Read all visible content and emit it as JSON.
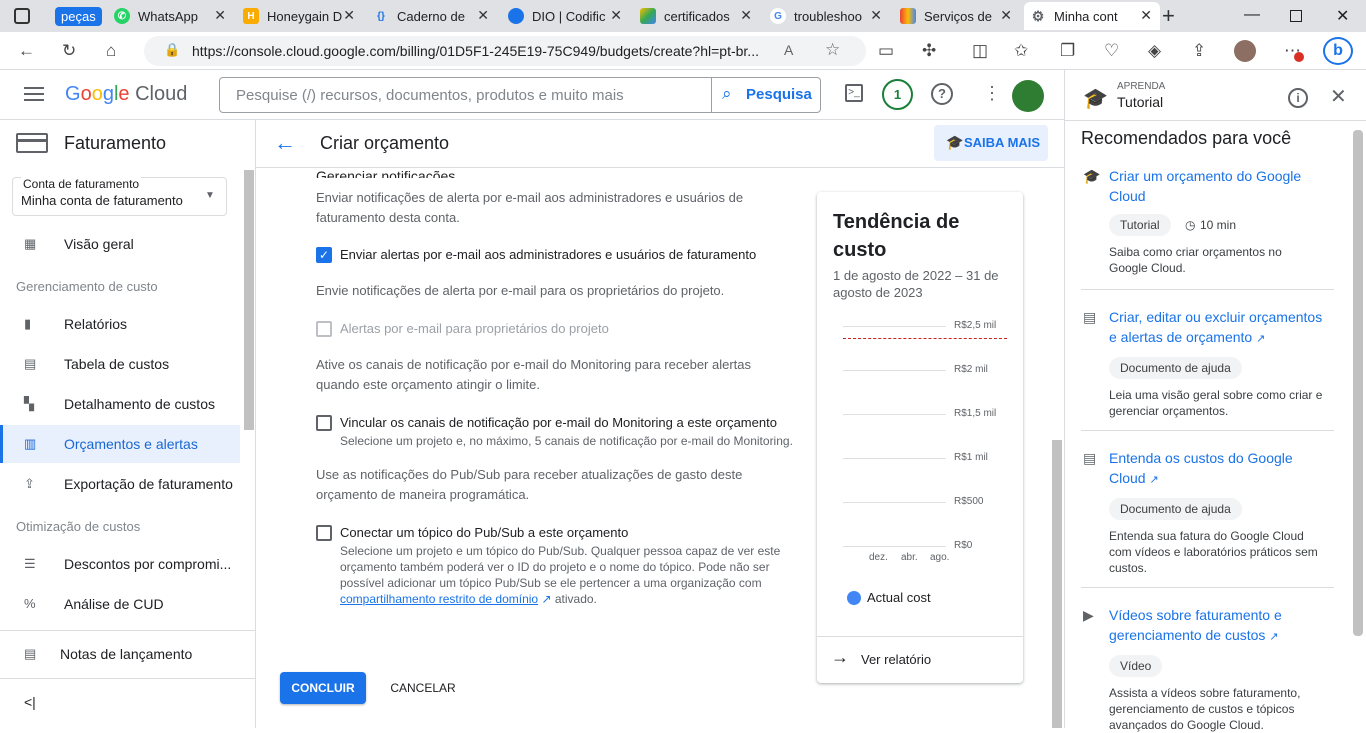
{
  "browser": {
    "tabs": [
      {
        "label": "peças",
        "color": "#1a73e8"
      },
      {
        "label": "WhatsApp",
        "color": "#25d366"
      },
      {
        "label": "Honeygain D",
        "color": "#f9ab00"
      },
      {
        "label": "Caderno de",
        "color": "#1a73e8"
      },
      {
        "label": "DIO | Codific",
        "color": "#1a73e8"
      },
      {
        "label": "certificados",
        "color": "#34a853"
      },
      {
        "label": "troubleshoo",
        "color": "#ea4335"
      },
      {
        "label": "Serviços de",
        "color": "#4285f4"
      },
      {
        "label": "Minha cont",
        "color": "#5f6368"
      }
    ],
    "url": "https://console.cloud.google.com/billing/01D5F1-245E19-75C949/budgets/create?hl=pt-br..."
  },
  "header": {
    "logo": "Google Cloud",
    "search_placeholder": "Pesquise (/) recursos, documentos, produtos e muito mais",
    "search_button": "Pesquisa",
    "notif_count": "1"
  },
  "sidebar": {
    "title": "Faturamento",
    "account_label": "Conta de faturamento",
    "account_value": "Minha conta de faturamento",
    "overview": "Visão geral",
    "section_cost": "Gerenciamento de custo",
    "reports": "Relatórios",
    "cost_table": "Tabela de custos",
    "cost_breakdown": "Detalhamento de custos",
    "budgets": "Orçamentos e alertas",
    "export": "Exportação de faturamento",
    "section_opt": "Otimização de custos",
    "commit": "Descontos por compromi...",
    "cud": "Análise de CUD",
    "release_notes": "Notas de lançamento"
  },
  "main": {
    "page_title": "Criar orçamento",
    "learn_more": "SAIBA MAIS",
    "section_heading": "Gerenciar notificações",
    "intro": "Enviar notificações de alerta por e-mail aos administradores e usuários de faturamento desta conta.",
    "cb1_label": "Enviar alertas por e-mail aos administradores e usuários de faturamento",
    "owners_text": "Envie notificações de alerta por e-mail para os proprietários do projeto.",
    "cb2_label": "Alertas por e-mail para proprietários do projeto",
    "monitoring_text": "Ative os canais de notificação por e-mail do Monitoring para receber alertas quando este orçamento atingir o limite.",
    "cb3_label": "Vincular os canais de notificação por e-mail do Monitoring a este orçamento",
    "cb3_sub": "Selecione um projeto e, no máximo, 5 canais de notificação por e-mail do Monitoring.",
    "pubsub_text": "Use as notificações do Pub/Sub para receber atualizações de gasto deste orçamento de maneira programática.",
    "cb4_label": "Conectar um tópico do Pub/Sub a este orçamento",
    "cb4_sub": "Selecione um projeto e um tópico do Pub/Sub. Qualquer pessoa capaz de ver este orçamento também poderá ver o ID do projeto e o nome do tópico. Pode não ser possível adicionar um tópico Pub/Sub se ele pertencer a uma organização com",
    "cb4_link": "compartilhamento restrito de domínio",
    "cb4_after": "ativado.",
    "done_button": "CONCLUIR",
    "cancel_button": "CANCELAR"
  },
  "trend": {
    "title": "Tendência de custo",
    "date_range": "1 de agosto de 2022 – 31 de agosto de 2023",
    "y_labels": [
      "R$2,5 mil",
      "R$2 mil",
      "R$1,5 mil",
      "R$1 mil",
      "R$500",
      "R$0"
    ],
    "x_labels": [
      "dez.",
      "abr.",
      "ago."
    ],
    "legend": "Actual cost",
    "legend_color": "#4285f4",
    "budget_line_color": "#c5221f",
    "view_report": "Ver relatório"
  },
  "learn": {
    "eyebrow": "APRENDA",
    "title": "Tutorial",
    "recommended": "Recomendados para você",
    "items": [
      {
        "title": "Criar um orçamento do Google Cloud",
        "chip": "Tutorial",
        "duration": "10 min",
        "desc": "Saiba como criar orçamentos no Google Cloud."
      },
      {
        "title": "Criar, editar ou excluir orçamentos e alertas de orçamento",
        "chip": "Documento de ajuda",
        "desc": "Leia uma visão geral sobre como criar e gerenciar orçamentos."
      },
      {
        "title": "Entenda os custos do Google Cloud",
        "chip": "Documento de ajuda",
        "desc": "Entenda sua fatura do Google Cloud com vídeos e laboratórios práticos sem custos."
      },
      {
        "title": "Vídeos sobre faturamento e gerenciamento de custos",
        "chip": "Vídeo",
        "desc": "Assista a vídeos sobre faturamento, gerenciamento de custos e tópicos avançados do Google Cloud."
      }
    ]
  }
}
